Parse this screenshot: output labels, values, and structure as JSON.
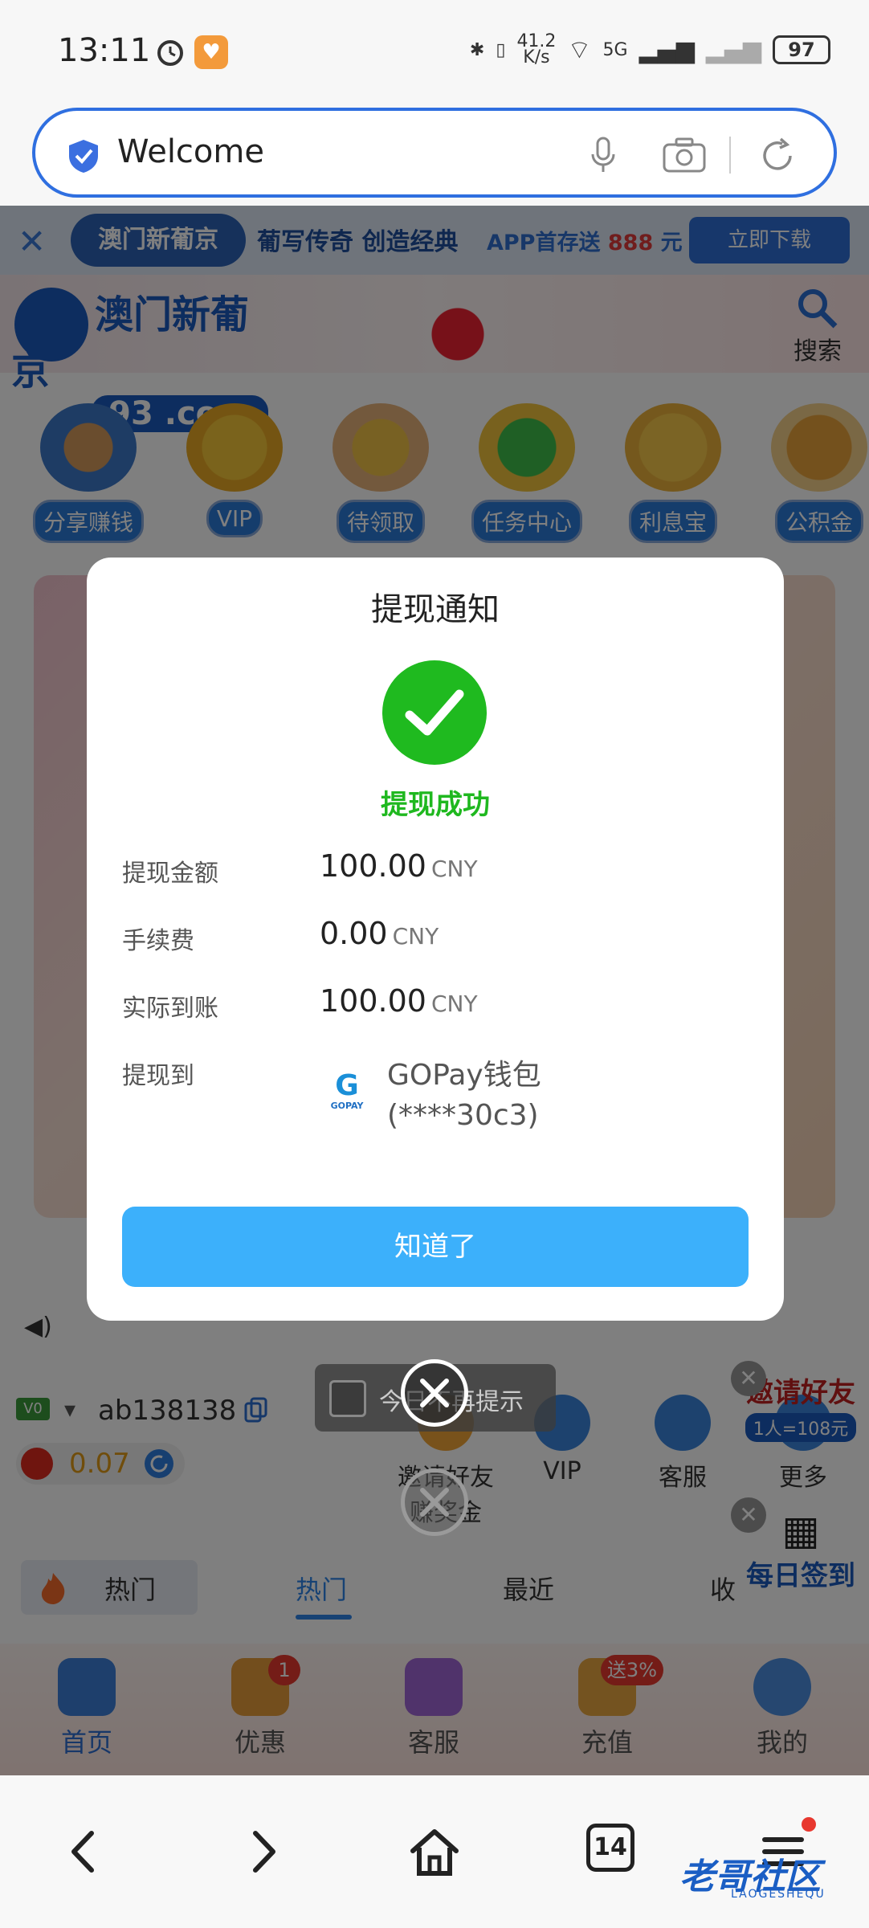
{
  "status_bar": {
    "time": "13:11",
    "net_speed": "41.2\nK/s",
    "net_speed_top": "41.2",
    "net_speed_bottom": "K/s",
    "signal_label": "5G",
    "battery": "97"
  },
  "address_bar": {
    "text": "Welcome"
  },
  "page": {
    "promo": {
      "slogan": "葡写传奇 创造经典",
      "logo_text": "澳门新葡京",
      "text_prefix": "APP首存送",
      "amount": "888",
      "text_suffix": "元",
      "download_button": "立即下载"
    },
    "header": {
      "logo_main": "澳门新葡京",
      "logo_sub": "93 .com",
      "search_label": "搜索"
    },
    "quick_links": [
      {
        "label": "分享赚钱"
      },
      {
        "label": "VIP"
      },
      {
        "label": "待领取"
      },
      {
        "label": "任务中心"
      },
      {
        "label": "利息宝"
      },
      {
        "label": "公积金"
      }
    ],
    "user": {
      "vip_tag": "V0",
      "username": "ab138138",
      "balance": "0.07"
    },
    "services": [
      {
        "label": "邀请好友\n赚奖金"
      },
      {
        "label": "VIP"
      },
      {
        "label": "客服"
      },
      {
        "label": "更多"
      }
    ],
    "tabs": [
      {
        "label": "热门"
      },
      {
        "label": "热门"
      },
      {
        "label": "最近"
      },
      {
        "label": "收"
      }
    ],
    "bottom_nav": [
      {
        "label": "首页",
        "badge": ""
      },
      {
        "label": "优惠",
        "badge": "1"
      },
      {
        "label": "客服",
        "badge": ""
      },
      {
        "label": "充值",
        "badge": "送3%"
      },
      {
        "label": "我的",
        "badge": ""
      }
    ],
    "side_floats": [
      {
        "text": "邀请好友",
        "sub": "1人=108元"
      },
      {
        "text": "每日签到",
        "sub": ""
      }
    ]
  },
  "dialog": {
    "title": "提现通知",
    "status": "提现成功",
    "rows": [
      {
        "label": "提现金额",
        "value": "100.00",
        "unit": "CNY"
      },
      {
        "label": "手续费",
        "value": "0.00",
        "unit": "CNY"
      },
      {
        "label": "实际到账",
        "value": "100.00",
        "unit": "CNY"
      },
      {
        "label": "提现到"
      }
    ],
    "wallet": {
      "logo_small": "GOPAY",
      "name": "GOPay钱包",
      "account": "(****30c3)"
    },
    "confirm_button": "知道了"
  },
  "overlay_controls": {
    "no_remind": "今日不再提示"
  },
  "browser_bar": {
    "tab_count": "14"
  },
  "watermark": {
    "text": "老哥社区",
    "sub": "LAOGESHEQU"
  },
  "colors": {
    "accent_blue": "#3cb0fb",
    "success_green": "#1fba1f",
    "address_border": "#2f6fe0"
  }
}
